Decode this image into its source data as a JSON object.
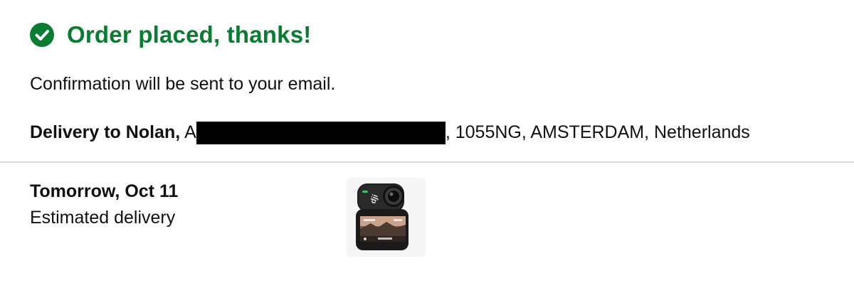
{
  "header": {
    "title": "Order placed, thanks!",
    "icon": "check-circle-icon",
    "accent_color": "#067d2f"
  },
  "confirmation_text": "Confirmation will be sent to your email.",
  "delivery": {
    "label": "Delivery to Nolan,",
    "name_prefix": "A",
    "address_rest": ", 1055NG, AMSTERDAM, Netherlands"
  },
  "shipment": {
    "date": "Tomorrow, Oct 11",
    "status": "Estimated delivery",
    "product_image": "action-camera-thumbnail",
    "product_brand_mark": "dji"
  }
}
